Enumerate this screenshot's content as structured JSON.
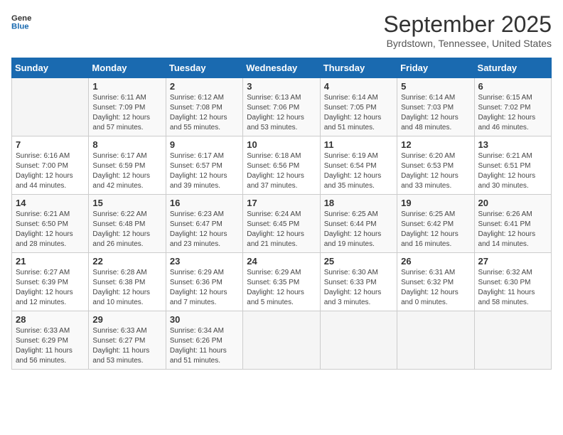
{
  "header": {
    "logo_line1": "General",
    "logo_line2": "Blue",
    "month": "September 2025",
    "location": "Byrdstown, Tennessee, United States"
  },
  "weekdays": [
    "Sunday",
    "Monday",
    "Tuesday",
    "Wednesday",
    "Thursday",
    "Friday",
    "Saturday"
  ],
  "weeks": [
    [
      {
        "day": "",
        "info": ""
      },
      {
        "day": "1",
        "info": "Sunrise: 6:11 AM\nSunset: 7:09 PM\nDaylight: 12 hours\nand 57 minutes."
      },
      {
        "day": "2",
        "info": "Sunrise: 6:12 AM\nSunset: 7:08 PM\nDaylight: 12 hours\nand 55 minutes."
      },
      {
        "day": "3",
        "info": "Sunrise: 6:13 AM\nSunset: 7:06 PM\nDaylight: 12 hours\nand 53 minutes."
      },
      {
        "day": "4",
        "info": "Sunrise: 6:14 AM\nSunset: 7:05 PM\nDaylight: 12 hours\nand 51 minutes."
      },
      {
        "day": "5",
        "info": "Sunrise: 6:14 AM\nSunset: 7:03 PM\nDaylight: 12 hours\nand 48 minutes."
      },
      {
        "day": "6",
        "info": "Sunrise: 6:15 AM\nSunset: 7:02 PM\nDaylight: 12 hours\nand 46 minutes."
      }
    ],
    [
      {
        "day": "7",
        "info": "Sunrise: 6:16 AM\nSunset: 7:00 PM\nDaylight: 12 hours\nand 44 minutes."
      },
      {
        "day": "8",
        "info": "Sunrise: 6:17 AM\nSunset: 6:59 PM\nDaylight: 12 hours\nand 42 minutes."
      },
      {
        "day": "9",
        "info": "Sunrise: 6:17 AM\nSunset: 6:57 PM\nDaylight: 12 hours\nand 39 minutes."
      },
      {
        "day": "10",
        "info": "Sunrise: 6:18 AM\nSunset: 6:56 PM\nDaylight: 12 hours\nand 37 minutes."
      },
      {
        "day": "11",
        "info": "Sunrise: 6:19 AM\nSunset: 6:54 PM\nDaylight: 12 hours\nand 35 minutes."
      },
      {
        "day": "12",
        "info": "Sunrise: 6:20 AM\nSunset: 6:53 PM\nDaylight: 12 hours\nand 33 minutes."
      },
      {
        "day": "13",
        "info": "Sunrise: 6:21 AM\nSunset: 6:51 PM\nDaylight: 12 hours\nand 30 minutes."
      }
    ],
    [
      {
        "day": "14",
        "info": "Sunrise: 6:21 AM\nSunset: 6:50 PM\nDaylight: 12 hours\nand 28 minutes."
      },
      {
        "day": "15",
        "info": "Sunrise: 6:22 AM\nSunset: 6:48 PM\nDaylight: 12 hours\nand 26 minutes."
      },
      {
        "day": "16",
        "info": "Sunrise: 6:23 AM\nSunset: 6:47 PM\nDaylight: 12 hours\nand 23 minutes."
      },
      {
        "day": "17",
        "info": "Sunrise: 6:24 AM\nSunset: 6:45 PM\nDaylight: 12 hours\nand 21 minutes."
      },
      {
        "day": "18",
        "info": "Sunrise: 6:25 AM\nSunset: 6:44 PM\nDaylight: 12 hours\nand 19 minutes."
      },
      {
        "day": "19",
        "info": "Sunrise: 6:25 AM\nSunset: 6:42 PM\nDaylight: 12 hours\nand 16 minutes."
      },
      {
        "day": "20",
        "info": "Sunrise: 6:26 AM\nSunset: 6:41 PM\nDaylight: 12 hours\nand 14 minutes."
      }
    ],
    [
      {
        "day": "21",
        "info": "Sunrise: 6:27 AM\nSunset: 6:39 PM\nDaylight: 12 hours\nand 12 minutes."
      },
      {
        "day": "22",
        "info": "Sunrise: 6:28 AM\nSunset: 6:38 PM\nDaylight: 12 hours\nand 10 minutes."
      },
      {
        "day": "23",
        "info": "Sunrise: 6:29 AM\nSunset: 6:36 PM\nDaylight: 12 hours\nand 7 minutes."
      },
      {
        "day": "24",
        "info": "Sunrise: 6:29 AM\nSunset: 6:35 PM\nDaylight: 12 hours\nand 5 minutes."
      },
      {
        "day": "25",
        "info": "Sunrise: 6:30 AM\nSunset: 6:33 PM\nDaylight: 12 hours\nand 3 minutes."
      },
      {
        "day": "26",
        "info": "Sunrise: 6:31 AM\nSunset: 6:32 PM\nDaylight: 12 hours\nand 0 minutes."
      },
      {
        "day": "27",
        "info": "Sunrise: 6:32 AM\nSunset: 6:30 PM\nDaylight: 11 hours\nand 58 minutes."
      }
    ],
    [
      {
        "day": "28",
        "info": "Sunrise: 6:33 AM\nSunset: 6:29 PM\nDaylight: 11 hours\nand 56 minutes."
      },
      {
        "day": "29",
        "info": "Sunrise: 6:33 AM\nSunset: 6:27 PM\nDaylight: 11 hours\nand 53 minutes."
      },
      {
        "day": "30",
        "info": "Sunrise: 6:34 AM\nSunset: 6:26 PM\nDaylight: 11 hours\nand 51 minutes."
      },
      {
        "day": "",
        "info": ""
      },
      {
        "day": "",
        "info": ""
      },
      {
        "day": "",
        "info": ""
      },
      {
        "day": "",
        "info": ""
      }
    ]
  ]
}
